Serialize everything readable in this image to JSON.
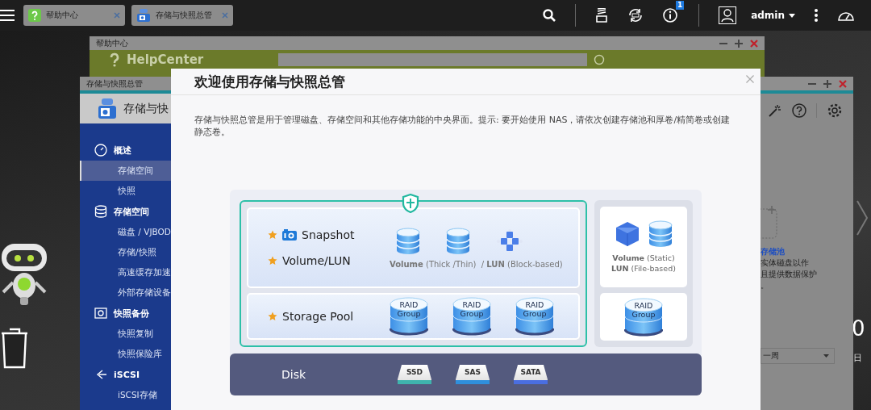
{
  "top_bar": {
    "tabs": [
      {
        "label": "帮助中心",
        "kind": "help"
      },
      {
        "label": "存储与快照总管",
        "kind": "storage"
      }
    ],
    "notification_badge": "1",
    "user": "admin"
  },
  "help_window": {
    "title": "帮助中心",
    "logo_text": "HelpCenter"
  },
  "storage_window": {
    "title": "存储与快照总管",
    "header": "存储与快",
    "sidebar": [
      {
        "kind": "overview",
        "label": "概述",
        "items": [
          {
            "label": "存储空间",
            "selected": true
          },
          {
            "label": "快照",
            "selected": false
          }
        ]
      },
      {
        "kind": "storage",
        "label": "存储空间",
        "items": [
          {
            "label": "磁盘 / VJBOD",
            "selected": false
          },
          {
            "label": "存储/快照",
            "selected": false
          },
          {
            "label": "高速缓存加速",
            "selected": false
          },
          {
            "label": "外部存储设备",
            "selected": false
          }
        ]
      },
      {
        "kind": "snapshot",
        "label": "快照备份",
        "items": [
          {
            "label": "快照复制",
            "selected": false
          },
          {
            "label": "快照保险库",
            "selected": false
          }
        ]
      },
      {
        "kind": "iscsi",
        "label": "iSCSI",
        "items": [
          {
            "label": "iSCSI存储",
            "selected": false
          }
        ]
      }
    ],
    "panel": {
      "heading": "存储池",
      "lines": [
        "实体磁盘以作",
        "且提供数据保护",
        "。"
      ],
      "dropdown": "一周",
      "number": "0",
      "day": "日"
    }
  },
  "dialog": {
    "title": "欢迎使用存储与快照总管",
    "description": "存储与快照总管是用于管理磁盘、存储空间和其他存储功能的中央界面。提示: 要开始使用 NAS，请依次创建存储池和厚卷/精简卷或创建静态卷。",
    "diagram": {
      "snapshot_label": "Snapshot",
      "volume_label": "Volume/LUN",
      "volume_caption": "**Volume** (Thick /Thin)  / **LUN** (Block-based)",
      "pool_label": "Storage Pool",
      "raid_groups": [
        "RAID Group",
        "RAID Group",
        "RAID Group"
      ],
      "static_captions": [
        "**Volume** (Static)",
        "**LUN** (File-based)"
      ],
      "static_raid": "RAID Group",
      "disk_label": "Disk",
      "disks": [
        {
          "label": "SSD",
          "color": "#3fb3ad"
        },
        {
          "label": "SAS",
          "color": "#2f8fdc"
        },
        {
          "label": "SATA",
          "color": "#4a6ee0"
        }
      ]
    }
  }
}
